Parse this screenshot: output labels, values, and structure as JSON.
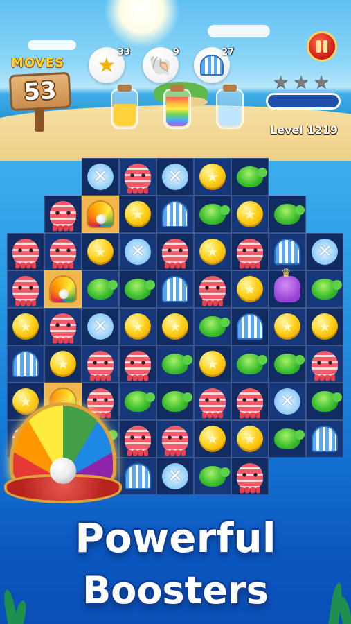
{
  "hud": {
    "moves_label": "MOVES",
    "moves_value": "53",
    "goals": [
      {
        "icon": "star-shell-icon",
        "count": "33",
        "jar_color": "#ffcc33"
      },
      {
        "icon": "conch-icon",
        "count": "9",
        "jar_color": "rainbow"
      },
      {
        "icon": "blue-shell-icon",
        "count": "27",
        "jar_color": "#bfe6ff"
      }
    ],
    "level_text": "Level 1219",
    "stars_earned": 0,
    "stars_total": 3,
    "score_progress": 0.0
  },
  "board": {
    "rows": [
      [
        null,
        null,
        "x",
        "o",
        "x",
        "s",
        "t",
        null,
        null
      ],
      [
        null,
        "o",
        "R",
        "s",
        "h",
        "t",
        "s",
        "t",
        null
      ],
      [
        "o",
        "o",
        "s",
        "x",
        "o",
        "s",
        "o",
        "h",
        "x"
      ],
      [
        "o",
        "R",
        "t",
        "t",
        "h",
        "o",
        "s",
        "q",
        "t"
      ],
      [
        "s",
        "o",
        "x",
        "s",
        "s",
        "t",
        "h",
        "s",
        "s"
      ],
      [
        "h",
        "s",
        "o",
        "o",
        "t",
        "s",
        "t",
        "t",
        "o"
      ],
      [
        "s",
        "R",
        "o",
        "t",
        "t",
        "o",
        "o",
        "x",
        "t"
      ],
      [
        "o",
        "o",
        "t",
        "o",
        "o",
        "s",
        "s",
        "t",
        "h"
      ],
      [
        null,
        null,
        "h",
        "h",
        "x",
        "t",
        "o",
        null,
        null
      ]
    ],
    "legend": {
      "o": "octopus",
      "s": "starfish-shell",
      "t": "turtle",
      "h": "striped-shell",
      "x": "cross-shell",
      "q": "squid",
      "R": "rainbow-pearl-shell"
    }
  },
  "booster": {
    "icon": "rainbow-pearl-shell-icon"
  },
  "promo": {
    "line1": "Powerful",
    "line2": "Boosters"
  },
  "colors": {
    "sky": "#5fc0f2",
    "ocean": "#1679d6",
    "text_outline": "#0d3f99",
    "tile_dark": "#102c63"
  }
}
